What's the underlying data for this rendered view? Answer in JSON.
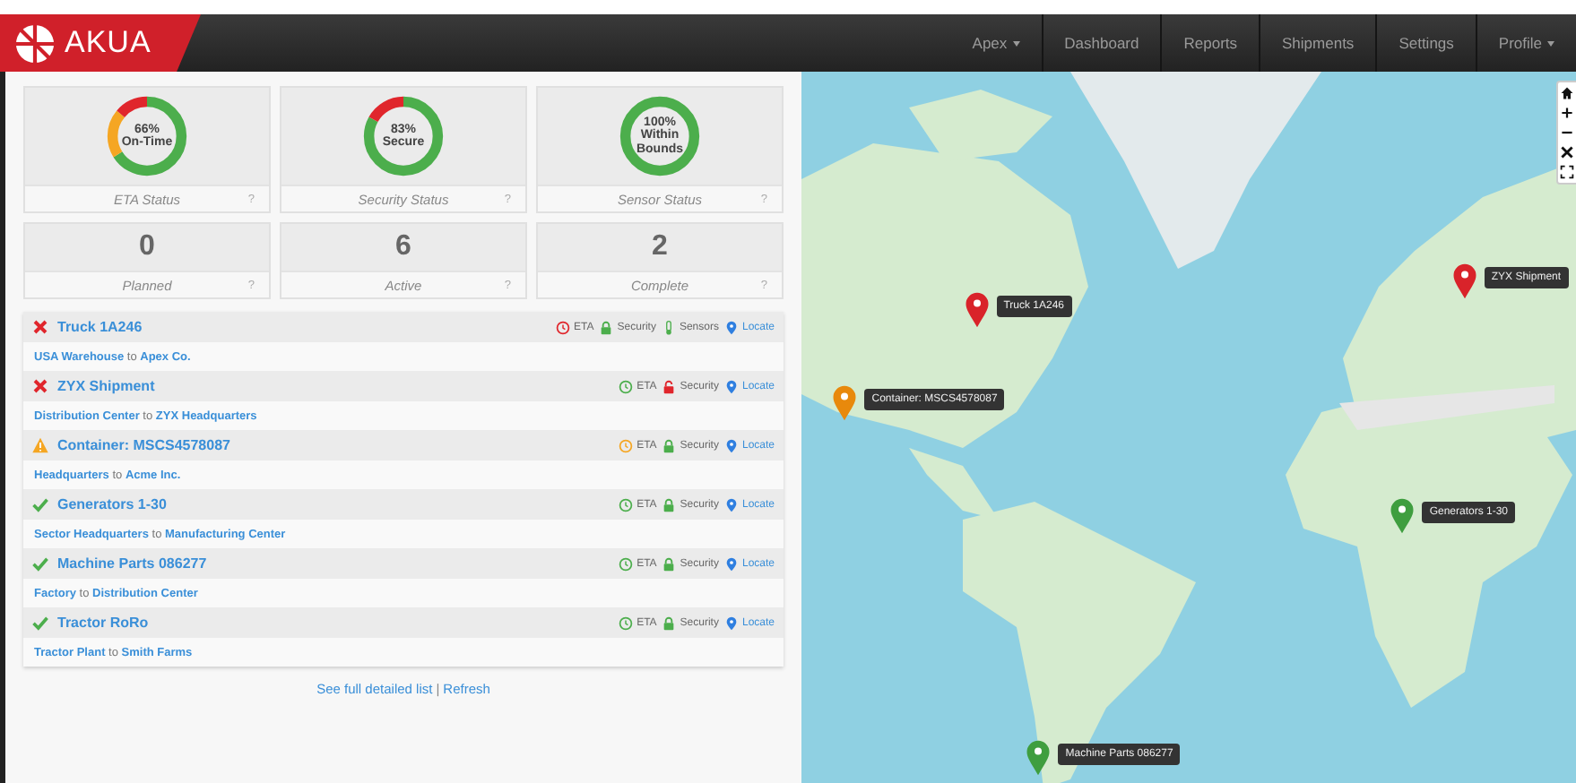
{
  "navbar": {
    "brand": "AKUA",
    "items": [
      {
        "label": "Apex",
        "dropdown": true
      },
      {
        "label": "Dashboard",
        "dropdown": false
      },
      {
        "label": "Reports",
        "dropdown": false
      },
      {
        "label": "Shipments",
        "dropdown": false
      },
      {
        "label": "Settings",
        "dropdown": false
      },
      {
        "label": "Profile",
        "dropdown": true
      }
    ]
  },
  "gauges": [
    {
      "value": "66%",
      "caption": "On-Time",
      "label": "ETA Status",
      "help": "?",
      "segments": [
        {
          "color": "#4cae4c",
          "level": 0.66
        },
        {
          "color": "#f5a623",
          "level": 0.2
        },
        {
          "color": "#e0262c",
          "level": 0.14
        }
      ]
    },
    {
      "value": "83%",
      "caption": "Secure",
      "label": "Security Status",
      "help": "?",
      "segments": [
        {
          "color": "#4cae4c",
          "level": 0.83
        },
        {
          "color": "#e0262c",
          "level": 0.17
        }
      ]
    },
    {
      "value": "100%",
      "caption": "Within Bounds",
      "label": "Sensor Status",
      "help": "?",
      "segments": [
        {
          "color": "#4cae4c",
          "level": 1
        }
      ]
    }
  ],
  "counts": [
    {
      "value": "0",
      "label": "Planned",
      "help": "?"
    },
    {
      "value": "6",
      "label": "Active",
      "help": "?"
    },
    {
      "value": "2",
      "label": "Complete",
      "help": "?"
    }
  ],
  "shipments": [
    {
      "kind": "failed",
      "title": "Truck 1A246",
      "from": "USA Warehouse",
      "connector": "to",
      "to": "Apex Co.",
      "indicators": [
        {
          "kind": "eta",
          "label": "ETA",
          "color": "#e0262c"
        },
        {
          "kind": "security",
          "label": "Security",
          "locked": true,
          "color": "#4cae4c"
        },
        {
          "kind": "sensors",
          "label": "Sensors",
          "color": "#4cae4c"
        },
        {
          "kind": "locate",
          "label": "Locate"
        }
      ]
    },
    {
      "kind": "failed",
      "title": "ZYX Shipment",
      "from": "Distribution Center",
      "connector": "to",
      "to": "ZYX Headquarters",
      "indicators": [
        {
          "kind": "eta",
          "label": "ETA",
          "color": "#4cae4c"
        },
        {
          "kind": "security",
          "label": "Security",
          "locked": false,
          "color": "#e0262c"
        },
        {
          "kind": "locate",
          "label": "Locate"
        }
      ]
    },
    {
      "kind": "warning",
      "title": "Container: MSCS4578087",
      "from": "Headquarters",
      "connector": "to",
      "to": "Acme Inc.",
      "indicators": [
        {
          "kind": "eta",
          "label": "ETA",
          "color": "#f5a623"
        },
        {
          "kind": "security",
          "label": "Security",
          "locked": true,
          "color": "#4cae4c"
        },
        {
          "kind": "locate",
          "label": "Locate"
        }
      ]
    },
    {
      "kind": "success",
      "title": "Generators 1-30",
      "from": "Sector Headquarters",
      "connector": "to",
      "to": "Manufacturing Center",
      "indicators": [
        {
          "kind": "eta",
          "label": "ETA",
          "color": "#4cae4c"
        },
        {
          "kind": "security",
          "label": "Security",
          "locked": true,
          "color": "#4cae4c"
        },
        {
          "kind": "locate",
          "label": "Locate"
        }
      ]
    },
    {
      "kind": "success",
      "title": "Machine Parts 086277",
      "from": "Factory",
      "connector": "to",
      "to": "Distribution Center",
      "indicators": [
        {
          "kind": "eta",
          "label": "ETA",
          "color": "#4cae4c"
        },
        {
          "kind": "security",
          "label": "Security",
          "locked": true,
          "color": "#4cae4c"
        },
        {
          "kind": "locate",
          "label": "Locate"
        }
      ]
    },
    {
      "kind": "success",
      "title": "Tractor RoRo",
      "from": "Tractor Plant",
      "connector": "to",
      "to": "Smith Farms",
      "indicators": [
        {
          "kind": "eta",
          "label": "ETA",
          "color": "#4cae4c"
        },
        {
          "kind": "security",
          "label": "Security",
          "locked": true,
          "color": "#4cae4c"
        },
        {
          "kind": "locate",
          "label": "Locate"
        }
      ]
    }
  ],
  "footer": {
    "links": [
      "See full detailed list",
      "Refresh"
    ],
    "separator": "|"
  },
  "map": {
    "markers": [
      {
        "label": "Truck 1A246",
        "color": "#d9232a"
      },
      {
        "label": "ZYX Shipment",
        "color": "#d9232a"
      },
      {
        "label": "Container: MSCS4578087",
        "color": "#e8890c"
      },
      {
        "label": "Generators 1-30",
        "color": "#3f9e3f"
      },
      {
        "label": "Machine Parts 086277",
        "color": "#3f9e3f"
      }
    ]
  }
}
